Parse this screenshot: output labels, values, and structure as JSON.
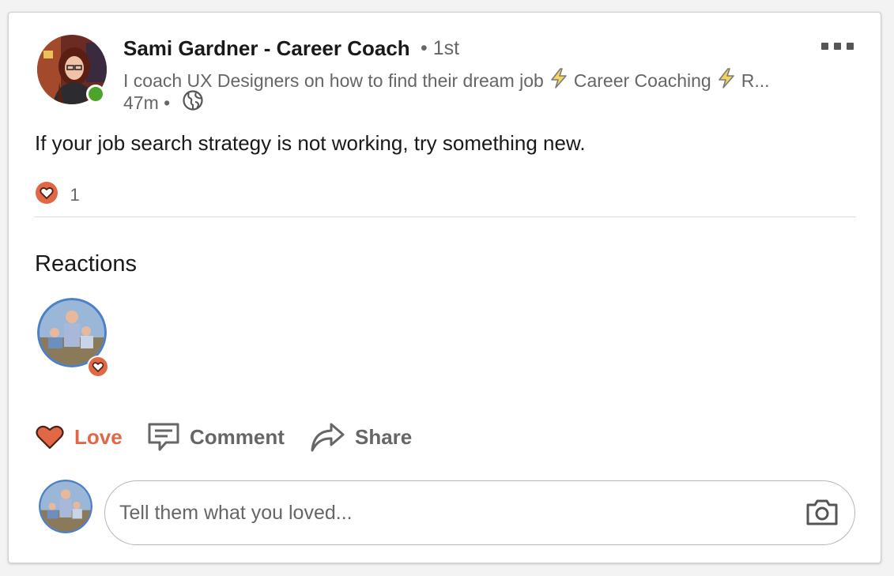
{
  "post": {
    "author": {
      "name": "Sami Gardner - Career Coach",
      "degree": "• 1st",
      "headline_parts": [
        "I coach UX Designers on how to find their dream job",
        "Career Coaching",
        "R..."
      ],
      "time": "47m •",
      "visibility_icon": "globe-icon",
      "presence": "online"
    },
    "text": "If your job search strategy is not working, try something new.",
    "reaction_count": "1",
    "reaction_type": "love"
  },
  "reactions_section": {
    "heading": "Reactions"
  },
  "actions": {
    "love_label": "Love",
    "comment_label": "Comment",
    "share_label": "Share"
  },
  "comment": {
    "value": "",
    "placeholder": "Tell them what you loved..."
  },
  "icons": {
    "more": "more-horizontal-icon",
    "love": "heart-icon",
    "comment": "comment-icon",
    "share": "share-arrow-icon",
    "camera": "camera-icon",
    "headline_separator": "lightning-bolt-icon"
  },
  "colors": {
    "love_accent": "#e16745",
    "presence_green": "#4ba52a",
    "muted_text": "#666666",
    "avatar_ring_blue": "#4a7fc9"
  }
}
